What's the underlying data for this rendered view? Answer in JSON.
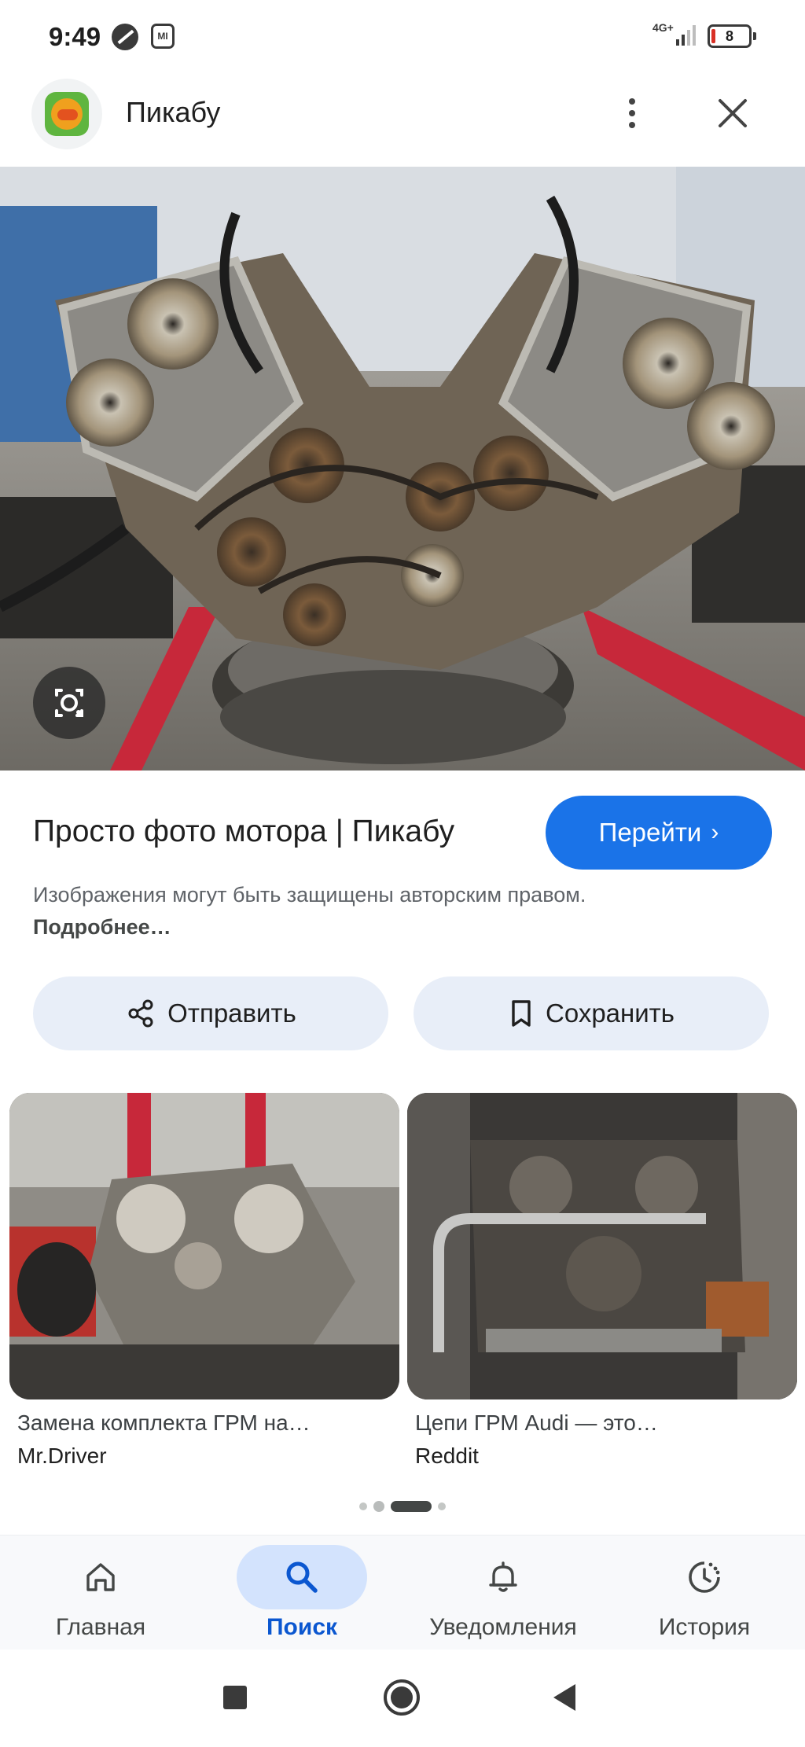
{
  "status_bar": {
    "time": "9:49",
    "network": "4G+",
    "battery": "8",
    "mi_label": "MI"
  },
  "header": {
    "site_name": "Пикабу",
    "favicon": "pikabu-logo",
    "more_icon": "more-vert-icon",
    "close_icon": "close-icon"
  },
  "result": {
    "title": "Просто фото мотора | Пикабу",
    "goto_label": "Перейти",
    "copyright_text": "Изображения могут быть защищены авторским правом.",
    "copyright_more": "Подробнее…"
  },
  "actions": {
    "share_label": "Отправить",
    "save_label": "Сохранить"
  },
  "related": [
    {
      "title": "Замена комплекта ГРМ на…",
      "source": "Mr.Driver"
    },
    {
      "title": "Цепи ГРМ Audi — это…",
      "source": "Reddit"
    }
  ],
  "pager": {
    "total": 4,
    "active": 3
  },
  "bottom_nav": [
    {
      "label": "Главная",
      "icon": "home-icon",
      "active": false
    },
    {
      "label": "Поиск",
      "icon": "search-icon",
      "active": true
    },
    {
      "label": "Уведомления",
      "icon": "bell-icon",
      "active": false
    },
    {
      "label": "История",
      "icon": "history-icon",
      "active": false
    }
  ],
  "colors": {
    "accent": "#1a73e8",
    "active_nav_pill": "#d3e3fd",
    "action_button_bg": "#e8eef8"
  }
}
